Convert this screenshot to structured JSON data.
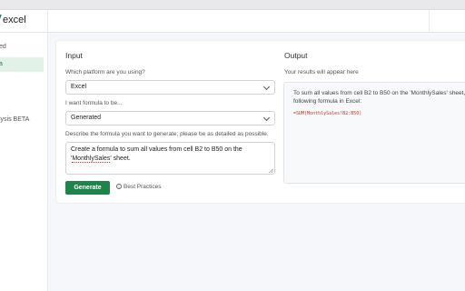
{
  "app": {
    "logo_text": "excel"
  },
  "sidebar": {
    "items": [
      {
        "label": "ed"
      },
      {
        "label": "a"
      },
      {
        "label": "lysis BETA"
      }
    ]
  },
  "input": {
    "title": "Input",
    "platform_label": "Which platform are you using?",
    "platform_value": "Excel",
    "mode_label": "I want formula to be...",
    "mode_value": "Generated",
    "describe_label": "Describe the formula you want to generate; please be as detailed as possible.",
    "describe_value_line1": "Create a formula to sum all values from cell B2 to B50 on the",
    "describe_value_quote_open": "'",
    "describe_value_underlined": "MonthlySales",
    "describe_value_quote_close": "' sheet.",
    "generate_label": "Generate",
    "best_practices_label": "Best Practices"
  },
  "output": {
    "title": "Output",
    "hint": "Your results will appear here",
    "result_line1": "To sum all values from cell B2 to B50 on the 'MonthlySales' sheet, us",
    "result_line2": "following formula in Excel:",
    "formula": "=SUM(MonthlySales!B2:B50)"
  }
}
